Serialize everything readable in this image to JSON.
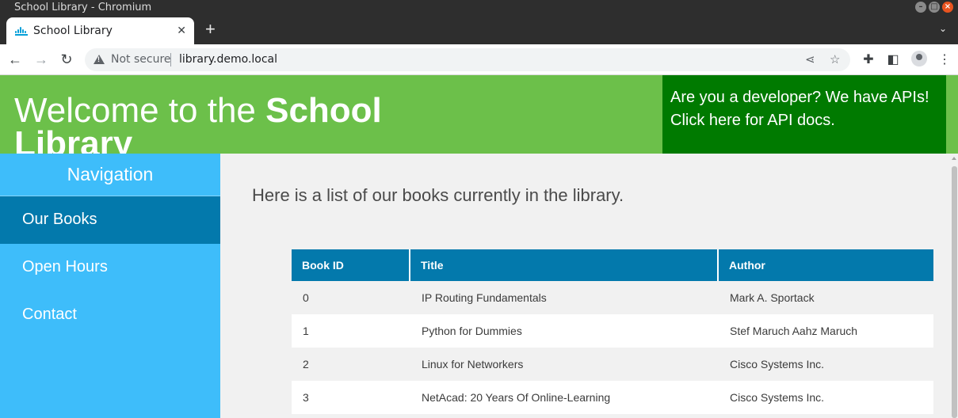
{
  "window": {
    "title": "School Library - Chromium"
  },
  "tab": {
    "title": "School Library",
    "close_icon": "close-icon"
  },
  "toolbar": {
    "security_label": "Not secure",
    "url": "library.demo.local"
  },
  "header": {
    "welcome_prefix": "Welcome to the ",
    "welcome_bold": "School Library",
    "api_line1": "Are you a developer? We have APIs!",
    "api_line2": "Click here for API docs.",
    "bg_color": "#6cc04a",
    "api_bg_color": "#007a00"
  },
  "sidebar": {
    "heading": "Navigation",
    "items": [
      {
        "label": "Our Books",
        "active": true
      },
      {
        "label": "Open Hours",
        "active": false
      },
      {
        "label": "Contact",
        "active": false
      }
    ],
    "bg_color": "#3ebdfa",
    "active_color": "#0379ac"
  },
  "main": {
    "intro": "Here is a list of our books currently in the library.",
    "table": {
      "columns": [
        "Book ID",
        "Title",
        "Author"
      ],
      "rows": [
        [
          "0",
          "IP Routing Fundamentals",
          "Mark A. Sportack"
        ],
        [
          "1",
          "Python for Dummies",
          "Stef Maruch Aahz Maruch"
        ],
        [
          "2",
          "Linux for Networkers",
          "Cisco Systems Inc."
        ],
        [
          "3",
          "NetAcad: 20 Years Of Online-Learning",
          "Cisco Systems Inc."
        ]
      ]
    }
  }
}
